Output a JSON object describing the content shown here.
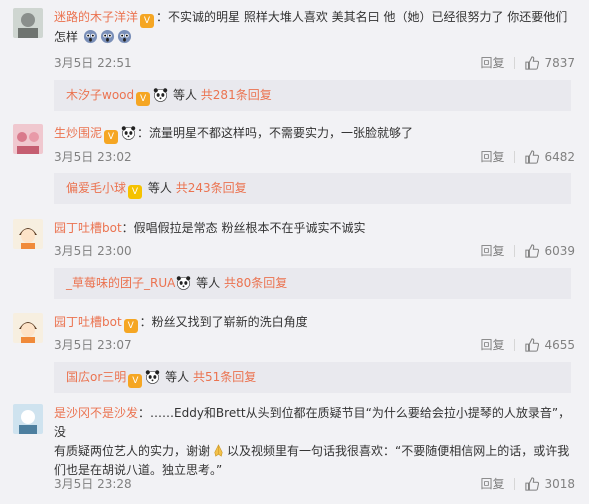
{
  "comments": [
    {
      "username": "迷路的木子洋洋",
      "text_line1": "：不实诚的明星 照样大堆人喜欢 美其名曰 他（她）已经很努力了 你还要他们",
      "text_line2": "怎样",
      "time": "3月5日 22:51",
      "reply_label": "回复",
      "likes": "7837",
      "sub_reply": {
        "username": "木汐子wood",
        "middle": "等人",
        "count": "共281条回复"
      }
    },
    {
      "username": "生炒围泥",
      "text_line1": "流量明星不都这样吗，不需要实力，一张脸就够了",
      "time": "3月5日 23:02",
      "reply_label": "回复",
      "likes": "6482",
      "sub_reply": {
        "username": "偏爱毛小球",
        "middle": "等人",
        "count": "共243条回复"
      }
    },
    {
      "username": "园丁吐槽bot",
      "text_line1": "：假唱假拉是常态 粉丝根本不在乎诚实不诚实",
      "time": "3月5日 23:00",
      "reply_label": "回复",
      "likes": "6039",
      "sub_reply": {
        "username": "_草莓味的团子_RUA",
        "middle": "等人",
        "count": "共80条回复"
      }
    },
    {
      "username": "园丁吐槽bot",
      "text_line1": "：粉丝又找到了崭新的洗白角度",
      "time": "3月5日 23:07",
      "reply_label": "回复",
      "likes": "4655",
      "sub_reply": {
        "username": "国広or三明",
        "middle": "等人",
        "count": "共51条回复"
      }
    },
    {
      "username": "是沙冈不是沙发",
      "text_line1": "：……Eddy和Brett从头到位都在质疑节目“为什么要给会拉小提琴的人放录音”，没",
      "text_line2": "有质疑两位艺人的实力，谢谢",
      "text_line2b": "以及视频里有一句话我很喜欢：“不要随便相信网上的话，或许我",
      "text_line3": "们也是在胡说八道。独立思考。”",
      "time": "3月5日 23:28",
      "reply_label": "回复",
      "likes": "3018"
    }
  ],
  "icons": {
    "badge": "vip-badge-icon",
    "emoji_panda": "panda-emoji-icon",
    "emoji_scared": "scared-face-emoji-icon",
    "emoji_pray": "pray-hands-emoji-icon",
    "like": "thumbs-up-icon"
  },
  "colors": {
    "username": "#eb7350",
    "meta": "#808080",
    "reply_bg": "#e9e9ee",
    "page_bg": "#f2f2f5"
  }
}
